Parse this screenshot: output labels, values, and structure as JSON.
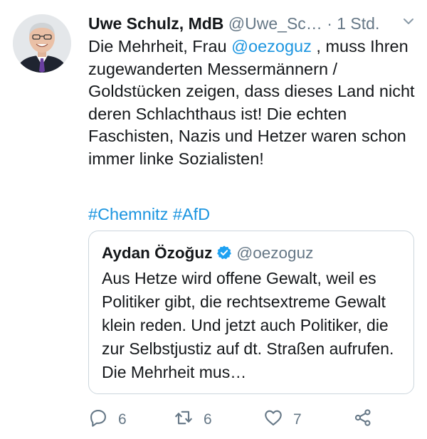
{
  "tweet": {
    "author_name": "Uwe Schulz, MdB",
    "author_handle": "@Uwe_Sc…",
    "separator": "·",
    "time": "1 Std.",
    "text_before_mention": "Die Mehrheit, Frau ",
    "mention": "@oezoguz",
    "text_after_mention": " , muss Ihren zugewanderten Messermännern / Goldstücken zeigen, dass dieses Land nicht deren Schlachthaus ist! Die echten Faschisten, Nazis und Hetzer waren schon immer linke Sozialisten!",
    "hashtag_1": "#Chemnitz",
    "hashtag_2": "#AfD"
  },
  "quote": {
    "author_name": "Aydan Özoğuz",
    "author_handle": "@oezoguz",
    "text": "Aus Hetze wird offene Gewalt, weil es Politiker gibt, die rechtsextreme Gewalt klein reden. Und jetzt auch Politiker, die zur Selbstjustiz auf dt. Straßen aufrufen. Die Mehrheit mus…"
  },
  "actions": {
    "replies": "6",
    "retweets": "6",
    "likes": "7"
  },
  "icons": {
    "reply": "reply-icon",
    "retweet": "retweet-icon",
    "like": "heart-icon",
    "share": "share-icon",
    "menu": "chevron-down-icon",
    "verified": "verified-badge-icon"
  },
  "colors": {
    "link": "#1b95e0",
    "secondary_text": "#657786",
    "primary_text": "#14171a",
    "quote_border": "#ccd6dd"
  }
}
